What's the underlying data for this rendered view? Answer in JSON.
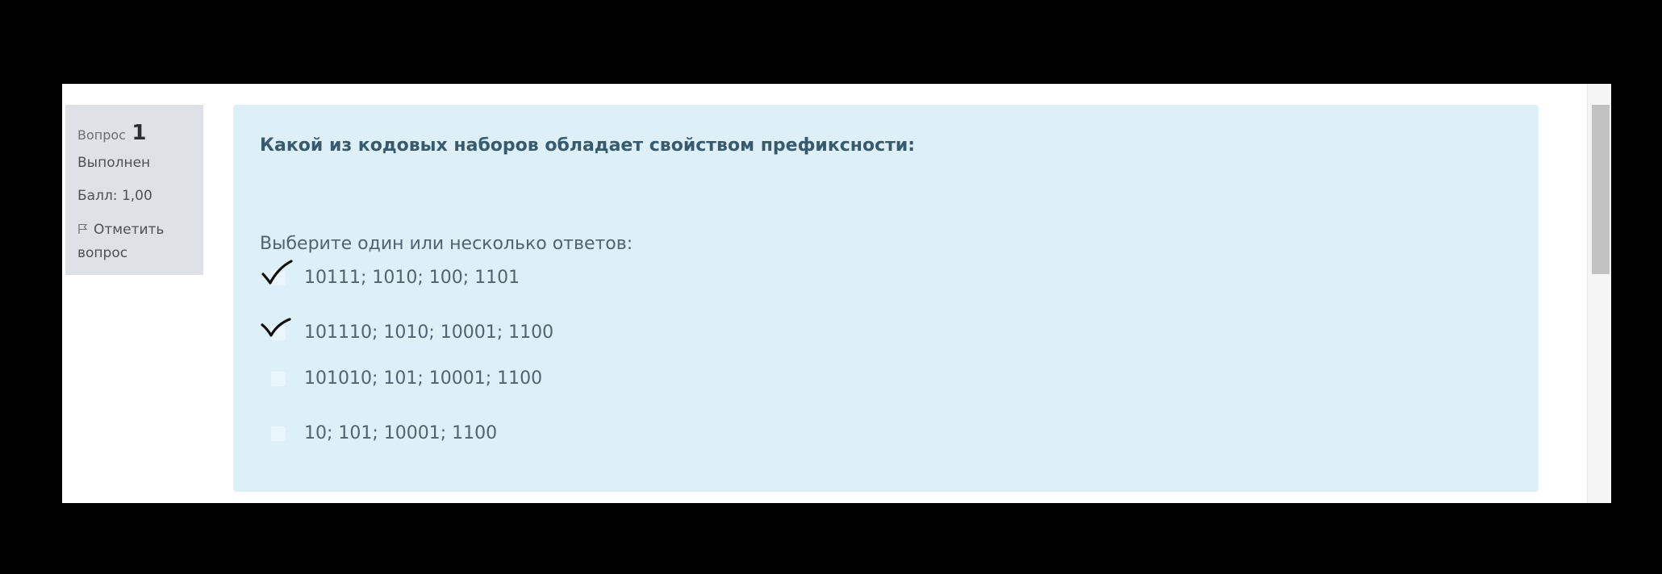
{
  "question_info": {
    "number_label": "Вопрос",
    "number": "1",
    "state": "Выполнен",
    "grade": "Балл: 1,00",
    "flag_label": "Отметить вопрос",
    "flag_icon": "flag-icon"
  },
  "question": {
    "text": "Какой из кодовых наборов обладает свойством префиксности:",
    "prompt": "Выберите один или несколько ответов:",
    "options": [
      {
        "label": "10111; 1010; 100; 1101",
        "checked": true
      },
      {
        "label": "101110; 1010; 10001; 1100",
        "checked": true
      },
      {
        "label": "101010; 101; 10001; 1100",
        "checked": false
      },
      {
        "label": "10; 101; 10001; 1100",
        "checked": false
      }
    ]
  },
  "colors": {
    "info_bg": "#dee2e6",
    "content_bg": "#def0f7",
    "question_text": "#385a6c",
    "option_text": "#4e6470",
    "checkmark": "#111111"
  }
}
